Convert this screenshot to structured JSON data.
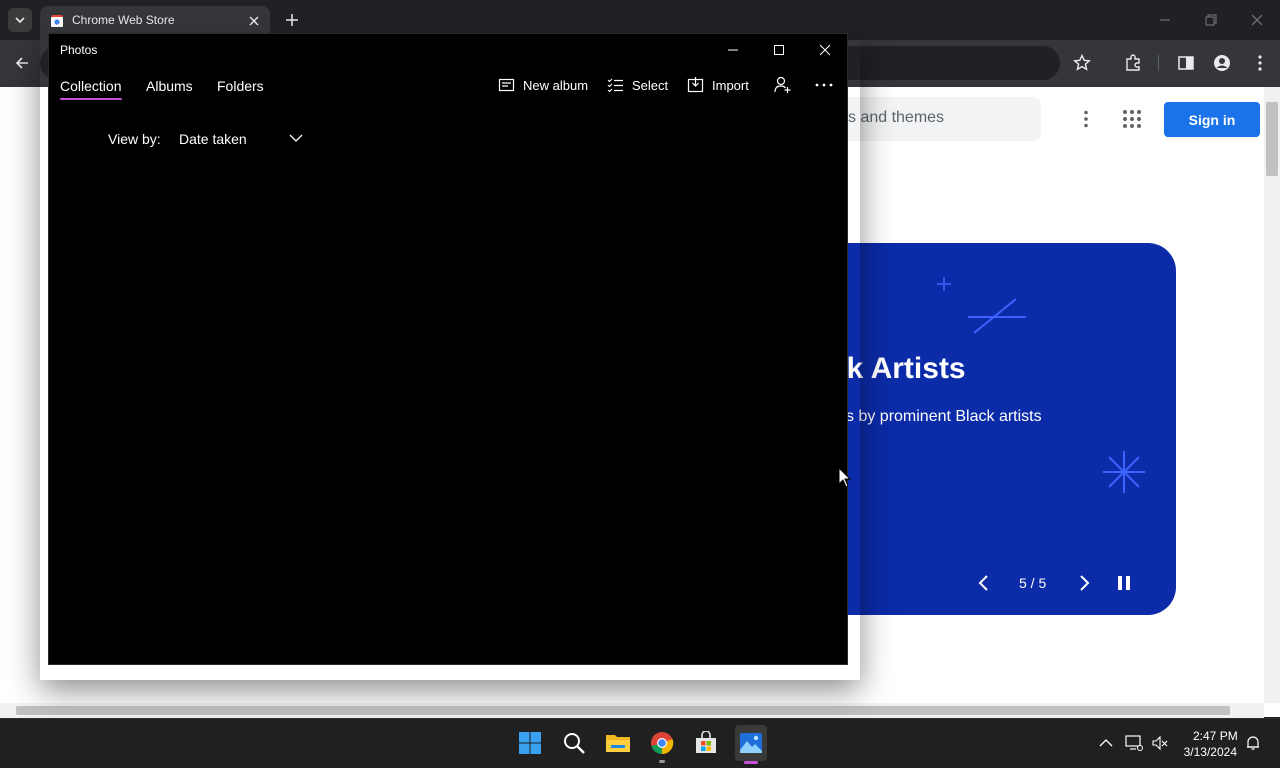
{
  "browser": {
    "tab_title": "Chrome Web Store",
    "search_placeholder": "s and themes",
    "signin_label": "Sign in",
    "banner": {
      "title": "ck Artists",
      "subtitle": "s by prominent Black artists",
      "pager": "5 / 5"
    },
    "icons": [
      "tab-search-icon",
      "chrome-web-store-favicon",
      "close-icon",
      "plus-icon",
      "minimize-icon",
      "restore-icon",
      "close-icon",
      "back-arrow-icon",
      "star-icon",
      "extensions-icon",
      "side-panel-icon",
      "profile-icon",
      "more-vertical-icon",
      "apps-grid-icon",
      "chevron-left-icon",
      "chevron-right-icon",
      "pause-icon"
    ],
    "colors": {
      "banner": "#0b2ba8",
      "signin": "#1a73e8",
      "chrome_dark": "#202124"
    }
  },
  "photos": {
    "window_title": "Photos",
    "tabs": [
      {
        "label": "Collection",
        "selected": true
      },
      {
        "label": "Albums",
        "selected": false
      },
      {
        "label": "Folders",
        "selected": false
      }
    ],
    "commands": {
      "new_album": "New album",
      "select": "Select",
      "import": "Import"
    },
    "view_by_label": "View by:",
    "view_by_value": "Date taken",
    "accent": "#c64fd8"
  },
  "taskbar": {
    "apps": [
      "windows-start-icon",
      "search-icon",
      "file-explorer-icon",
      "chrome-icon",
      "microsoft-store-icon",
      "photos-icon"
    ],
    "time": "2:47 PM",
    "date": "3/13/2024"
  }
}
